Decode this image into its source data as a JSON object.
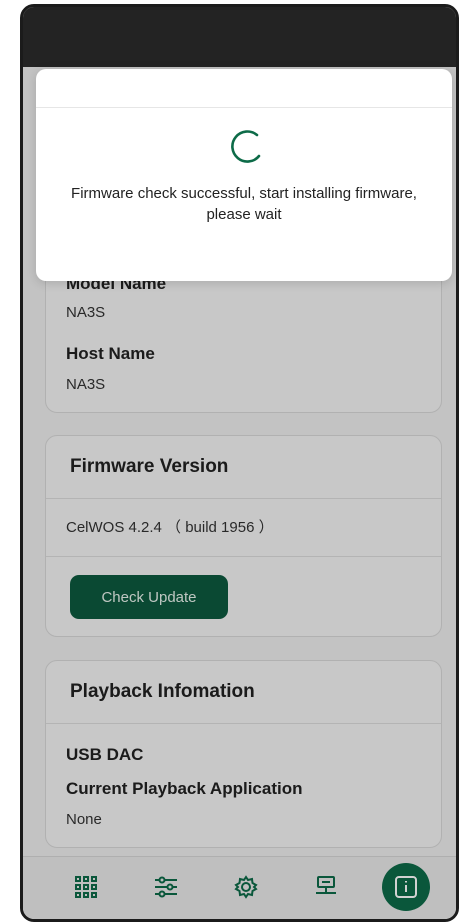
{
  "device_info": {
    "model_label": "Model Name",
    "model_value": "NA3S",
    "host_label": "Host Name",
    "host_value": "NA3S"
  },
  "firmware": {
    "title": "Firmware Version",
    "version": "CelWOS 4.2.4 （ build 1956 ）",
    "check_button": "Check Update"
  },
  "playback": {
    "title": "Playback Infomation",
    "output_label": "USB DAC",
    "app_label": "Current Playback Application",
    "app_value": "None"
  },
  "dialog": {
    "message": "Firmware check successful, start installing firmware, please wait"
  },
  "navbar": {
    "items": [
      {
        "icon": "grid-icon",
        "active": false
      },
      {
        "icon": "sliders-icon",
        "active": false
      },
      {
        "icon": "gear-icon",
        "active": false
      },
      {
        "icon": "network-icon",
        "active": false
      },
      {
        "icon": "info-icon",
        "active": true
      }
    ]
  },
  "colors": {
    "accent": "#0d6b48",
    "button": "#0d5a3f",
    "statusbar": "#2b2b2b"
  }
}
